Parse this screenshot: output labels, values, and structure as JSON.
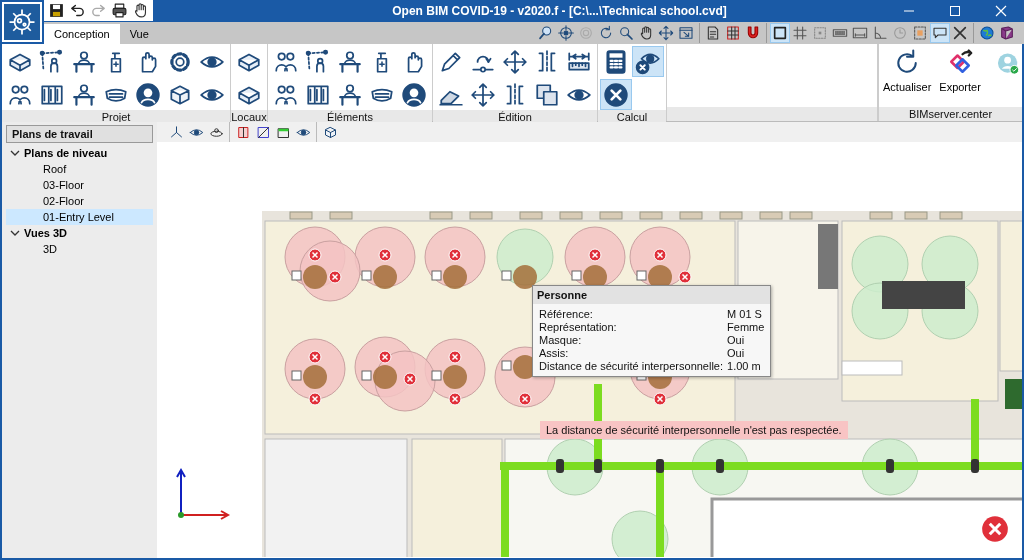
{
  "window": {
    "title": "Open BIM COVID-19 - v2020.f - [C:\\...\\Technical school.cvd]"
  },
  "quick_access": [
    {
      "kind": "save"
    },
    {
      "kind": "undo"
    },
    {
      "kind": "redo"
    },
    {
      "kind": "print"
    },
    {
      "kind": "hand"
    }
  ],
  "tabs": [
    {
      "label": "Conception",
      "selected": true
    },
    {
      "label": "Vue",
      "selected": false
    }
  ],
  "toolbar": [
    [
      {
        "kind": "search",
        "selected": false
      },
      {
        "kind": "target",
        "selected": false
      },
      {
        "kind": "circle",
        "selected": false
      },
      {
        "kind": "refresh",
        "selected": false
      },
      {
        "kind": "zoom",
        "selected": false
      },
      {
        "kind": "hand",
        "selected": false
      },
      {
        "kind": "move",
        "selected": false
      },
      {
        "kind": "window",
        "selected": false
      }
    ],
    [
      {
        "kind": "document",
        "selected": false
      },
      {
        "kind": "griddoc",
        "selected": false
      },
      {
        "kind": "magnet",
        "selected": false
      }
    ],
    [
      {
        "kind": "square",
        "selected": true
      },
      {
        "kind": "grid",
        "selected": false
      },
      {
        "kind": "dotsquare",
        "selected": false
      },
      {
        "kind": "keyboard",
        "selected": false
      },
      {
        "kind": "scalebar",
        "selected": false
      },
      {
        "kind": "angle",
        "selected": false
      },
      {
        "kind": "clock",
        "selected": false
      },
      {
        "kind": "layers",
        "selected": false
      },
      {
        "kind": "bubble",
        "selected": true
      },
      {
        "kind": "tools",
        "selected": false
      }
    ],
    [
      {
        "kind": "globe",
        "selected": false
      },
      {
        "kind": "book",
        "selected": false
      }
    ]
  ],
  "ribbon": [
    {
      "label": "Projet",
      "buttons": [
        {
          "kind": "room",
          "selected": false
        },
        {
          "kind": "people",
          "selected": false
        },
        {
          "kind": "route",
          "selected": false
        },
        {
          "kind": "screen",
          "selected": false
        },
        {
          "kind": "desk",
          "selected": false
        },
        {
          "kind": "desk",
          "selected": false
        },
        {
          "kind": "sanitizer",
          "selected": false
        },
        {
          "kind": "mask",
          "selected": false
        },
        {
          "kind": "gloves",
          "selected": false
        },
        {
          "kind": "badge",
          "selected": false
        },
        {
          "kind": "gear",
          "selected": false
        },
        {
          "kind": "cube",
          "selected": false
        },
        {
          "kind": "eye",
          "selected": false
        },
        {
          "kind": "eye",
          "selected": false
        }
      ]
    },
    {
      "label": "Locaux",
      "buttons": [
        {
          "kind": "room",
          "selected": false
        },
        {
          "kind": "room",
          "selected": false
        }
      ]
    },
    {
      "label": "Éléments",
      "buttons": [
        {
          "kind": "people",
          "selected": false
        },
        {
          "kind": "people",
          "selected": false
        },
        {
          "kind": "route",
          "selected": false
        },
        {
          "kind": "screen",
          "selected": false
        },
        {
          "kind": "desk",
          "selected": false
        },
        {
          "kind": "desk",
          "selected": false
        },
        {
          "kind": "sanitizer",
          "selected": false
        },
        {
          "kind": "mask",
          "selected": false
        },
        {
          "kind": "gloves",
          "selected": false
        },
        {
          "kind": "badge",
          "selected": false
        }
      ]
    },
    {
      "label": "Édition",
      "buttons": [
        {
          "kind": "pencil",
          "selected": false
        },
        {
          "kind": "eraser",
          "selected": false
        },
        {
          "kind": "rotate",
          "selected": false
        },
        {
          "kind": "move",
          "selected": false
        },
        {
          "kind": "move",
          "selected": false
        },
        {
          "kind": "mirror",
          "selected": false
        },
        {
          "kind": "mirror",
          "selected": false
        },
        {
          "kind": "copy",
          "selected": false
        },
        {
          "kind": "ruler",
          "selected": false
        },
        {
          "kind": "eye",
          "selected": false
        }
      ]
    },
    {
      "label": "Calcul",
      "buttons": [
        {
          "kind": "calculator",
          "selected": false
        },
        {
          "kind": "cancel",
          "selected": true
        },
        {
          "kind": "eyex",
          "selected": true
        }
      ]
    }
  ],
  "bimserver": {
    "label": "BIMserver.center",
    "actions": [
      {
        "label": "Actualiser",
        "kind": "refresh"
      },
      {
        "label": "Exporter",
        "kind": "export"
      }
    ]
  },
  "sidebar": {
    "title": "Plans de travail",
    "tree": [
      {
        "label": "Plans de niveau",
        "expanded": true,
        "selected": false,
        "children": [
          {
            "label": "Roof",
            "selected": false
          },
          {
            "label": "03-Floor",
            "selected": false
          },
          {
            "label": "02-Floor",
            "selected": false
          },
          {
            "label": "01-Entry Level",
            "selected": true
          }
        ]
      },
      {
        "label": "Vues 3D",
        "expanded": true,
        "selected": false,
        "children": [
          {
            "label": "3D",
            "selected": false
          }
        ]
      }
    ]
  },
  "view_toolbar": [
    [
      {
        "kind": "axes"
      },
      {
        "kind": "eye"
      },
      {
        "kind": "orbit"
      }
    ],
    [
      {
        "kind": "wallpanel"
      },
      {
        "kind": "diagpanel"
      },
      {
        "kind": "toppanel"
      },
      {
        "kind": "eye"
      }
    ],
    [
      {
        "kind": "cube"
      }
    ]
  ],
  "tooltip": {
    "title": "Personne",
    "rows": [
      {
        "label": "Référence:",
        "value": "M 01 S"
      },
      {
        "label": "Représentation:",
        "value": "Femme"
      },
      {
        "label": "Masque:",
        "value": "Oui"
      },
      {
        "label": "Assis:",
        "value": "Oui"
      },
      {
        "label": "Distance de sécurité interpersonnelle:",
        "value": "1.00 m"
      }
    ]
  },
  "warning": "La distance de sécurité interpersonnelle n'est pas respectée."
}
